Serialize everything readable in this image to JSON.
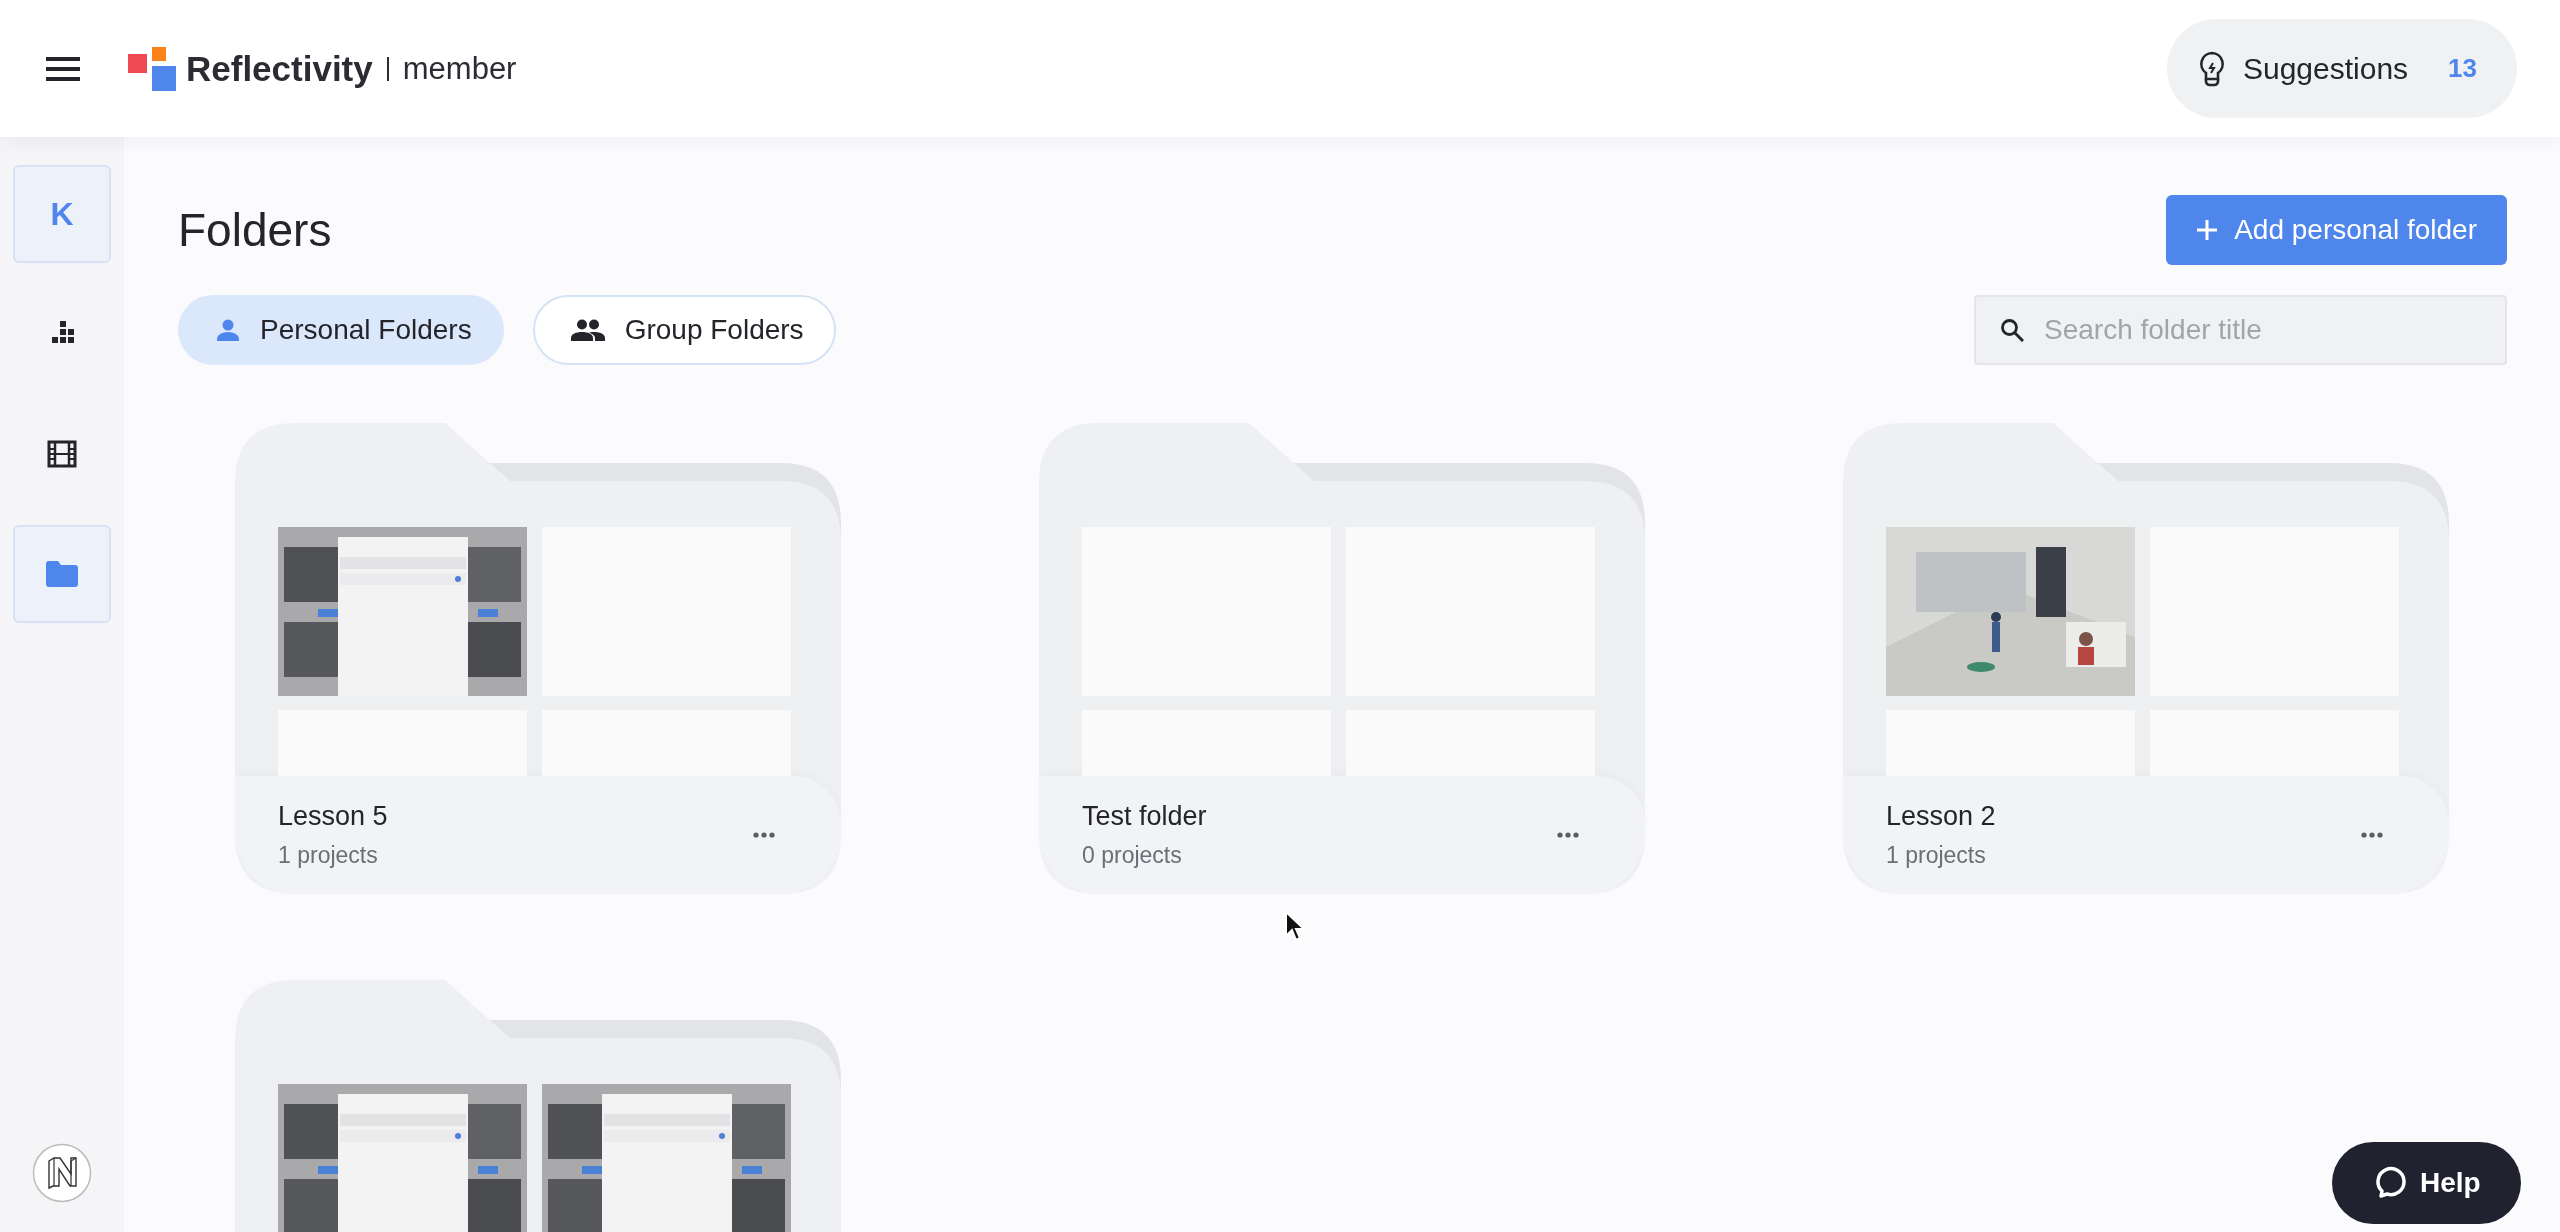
{
  "header": {
    "brand": "Reflectivity",
    "role": "member",
    "suggestions": {
      "label": "Suggestions",
      "count": "13"
    }
  },
  "sidebar": {
    "avatar": "K",
    "items": [
      {
        "selected": false
      },
      {
        "selected": false
      },
      {
        "selected": true
      }
    ]
  },
  "page": {
    "title": "Folders",
    "add_button": "Add personal folder",
    "search": {
      "placeholder": "Search folder title"
    },
    "tabs": [
      {
        "label": "Personal Folders",
        "selected": true
      },
      {
        "label": "Group Folders",
        "selected": false
      }
    ]
  },
  "folders": [
    {
      "name": "Lesson 5",
      "count": "1 projects",
      "slots": [
        {
          "kind": "picture"
        },
        {
          "kind": "empty"
        },
        {
          "kind": "empty"
        },
        {
          "kind": "empty"
        }
      ]
    },
    {
      "name": "Test folder",
      "count": "0 projects",
      "slots": [
        {
          "kind": "empty"
        },
        {
          "kind": "empty"
        },
        {
          "kind": "empty"
        },
        {
          "kind": "empty"
        }
      ]
    },
    {
      "name": "Lesson 2",
      "count": "1 projects",
      "slots": [
        {
          "kind": "picture"
        },
        {
          "kind": "empty"
        },
        {
          "kind": "empty"
        },
        {
          "kind": "empty"
        }
      ]
    },
    {
      "slots": [
        {
          "kind": "picture"
        },
        {
          "kind": "picture"
        }
      ]
    }
  ],
  "help": {
    "label": "Help"
  }
}
